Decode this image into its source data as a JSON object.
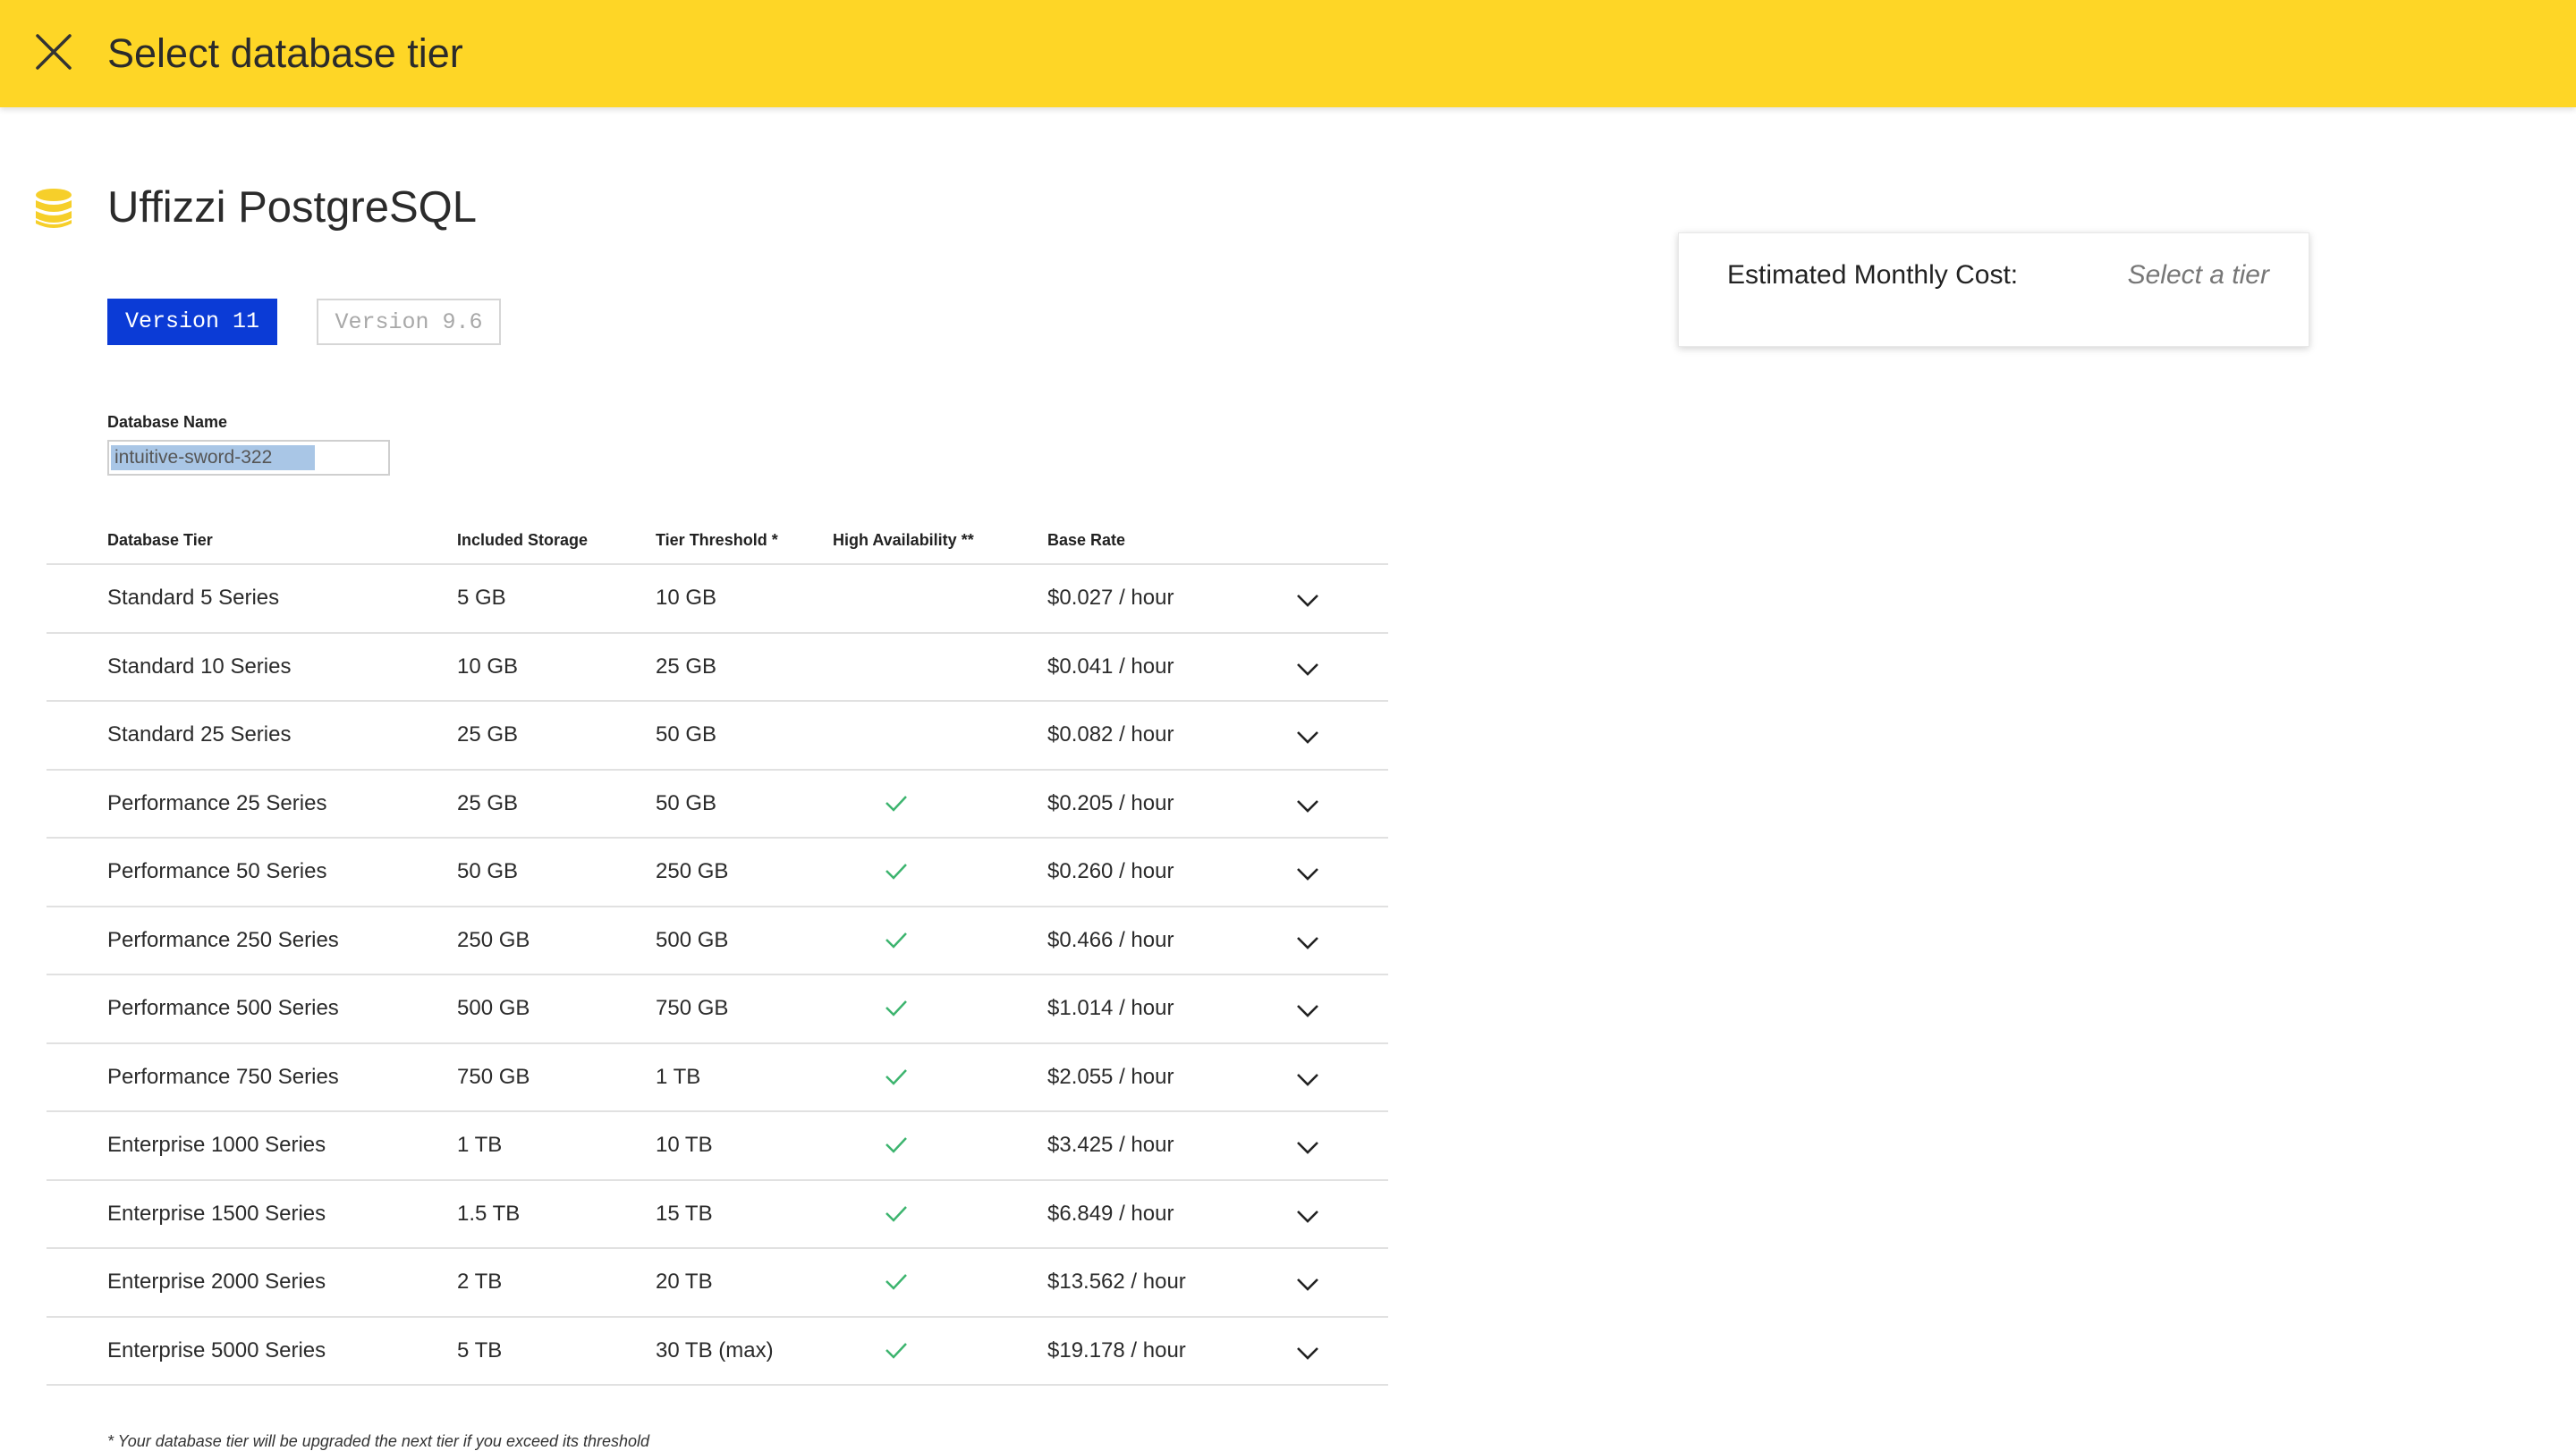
{
  "header": {
    "title": "Select database tier",
    "close_icon": "close-icon"
  },
  "product": {
    "name": "Uffizzi PostgreSQL",
    "icon": "database-icon",
    "icon_color": "#f6cf2a"
  },
  "versions": [
    {
      "label": "Version 11",
      "selected": true
    },
    {
      "label": "Version 9.6",
      "selected": false
    }
  ],
  "database_name": {
    "label": "Database Name",
    "value": "intuitive-sword-322"
  },
  "table": {
    "columns": [
      "Database Tier",
      "Included Storage",
      "Tier Threshold *",
      "High Availability **",
      "Base Rate"
    ],
    "rows": [
      {
        "tier": "Standard 5 Series",
        "storage": "5 GB",
        "threshold": "10 GB",
        "ha": false,
        "rate": "$0.027 / hour"
      },
      {
        "tier": "Standard 10 Series",
        "storage": "10 GB",
        "threshold": "25 GB",
        "ha": false,
        "rate": "$0.041 / hour"
      },
      {
        "tier": "Standard 25 Series",
        "storage": "25 GB",
        "threshold": "50 GB",
        "ha": false,
        "rate": "$0.082 / hour"
      },
      {
        "tier": "Performance 25 Series",
        "storage": "25 GB",
        "threshold": "50 GB",
        "ha": true,
        "rate": "$0.205 / hour"
      },
      {
        "tier": "Performance 50 Series",
        "storage": "50 GB",
        "threshold": "250 GB",
        "ha": true,
        "rate": "$0.260 / hour"
      },
      {
        "tier": "Performance 250 Series",
        "storage": "250 GB",
        "threshold": "500 GB",
        "ha": true,
        "rate": "$0.466 / hour"
      },
      {
        "tier": "Performance 500 Series",
        "storage": "500 GB",
        "threshold": "750 GB",
        "ha": true,
        "rate": "$1.014 / hour"
      },
      {
        "tier": "Performance 750 Series",
        "storage": "750 GB",
        "threshold": "1 TB",
        "ha": true,
        "rate": "$2.055 / hour"
      },
      {
        "tier": "Enterprise 1000 Series",
        "storage": "1 TB",
        "threshold": "10 TB",
        "ha": true,
        "rate": "$3.425 / hour"
      },
      {
        "tier": "Enterprise 1500 Series",
        "storage": "1.5 TB",
        "threshold": "15 TB",
        "ha": true,
        "rate": "$6.849 / hour"
      },
      {
        "tier": "Enterprise 2000 Series",
        "storage": "2 TB",
        "threshold": "20 TB",
        "ha": true,
        "rate": "$13.562 / hour"
      },
      {
        "tier": "Enterprise 5000 Series",
        "storage": "5 TB",
        "threshold": "30 TB (max)",
        "ha": true,
        "rate": "$19.178 / hour"
      }
    ]
  },
  "footnote": "* Your database tier will be upgraded the next tier if you exceed its threshold",
  "cost": {
    "label": "Estimated Monthly Cost:",
    "value": "Select a tier"
  },
  "colors": {
    "header_bg": "#fed626",
    "version_active": "#0b3bd6",
    "check": "#3cb46e"
  }
}
